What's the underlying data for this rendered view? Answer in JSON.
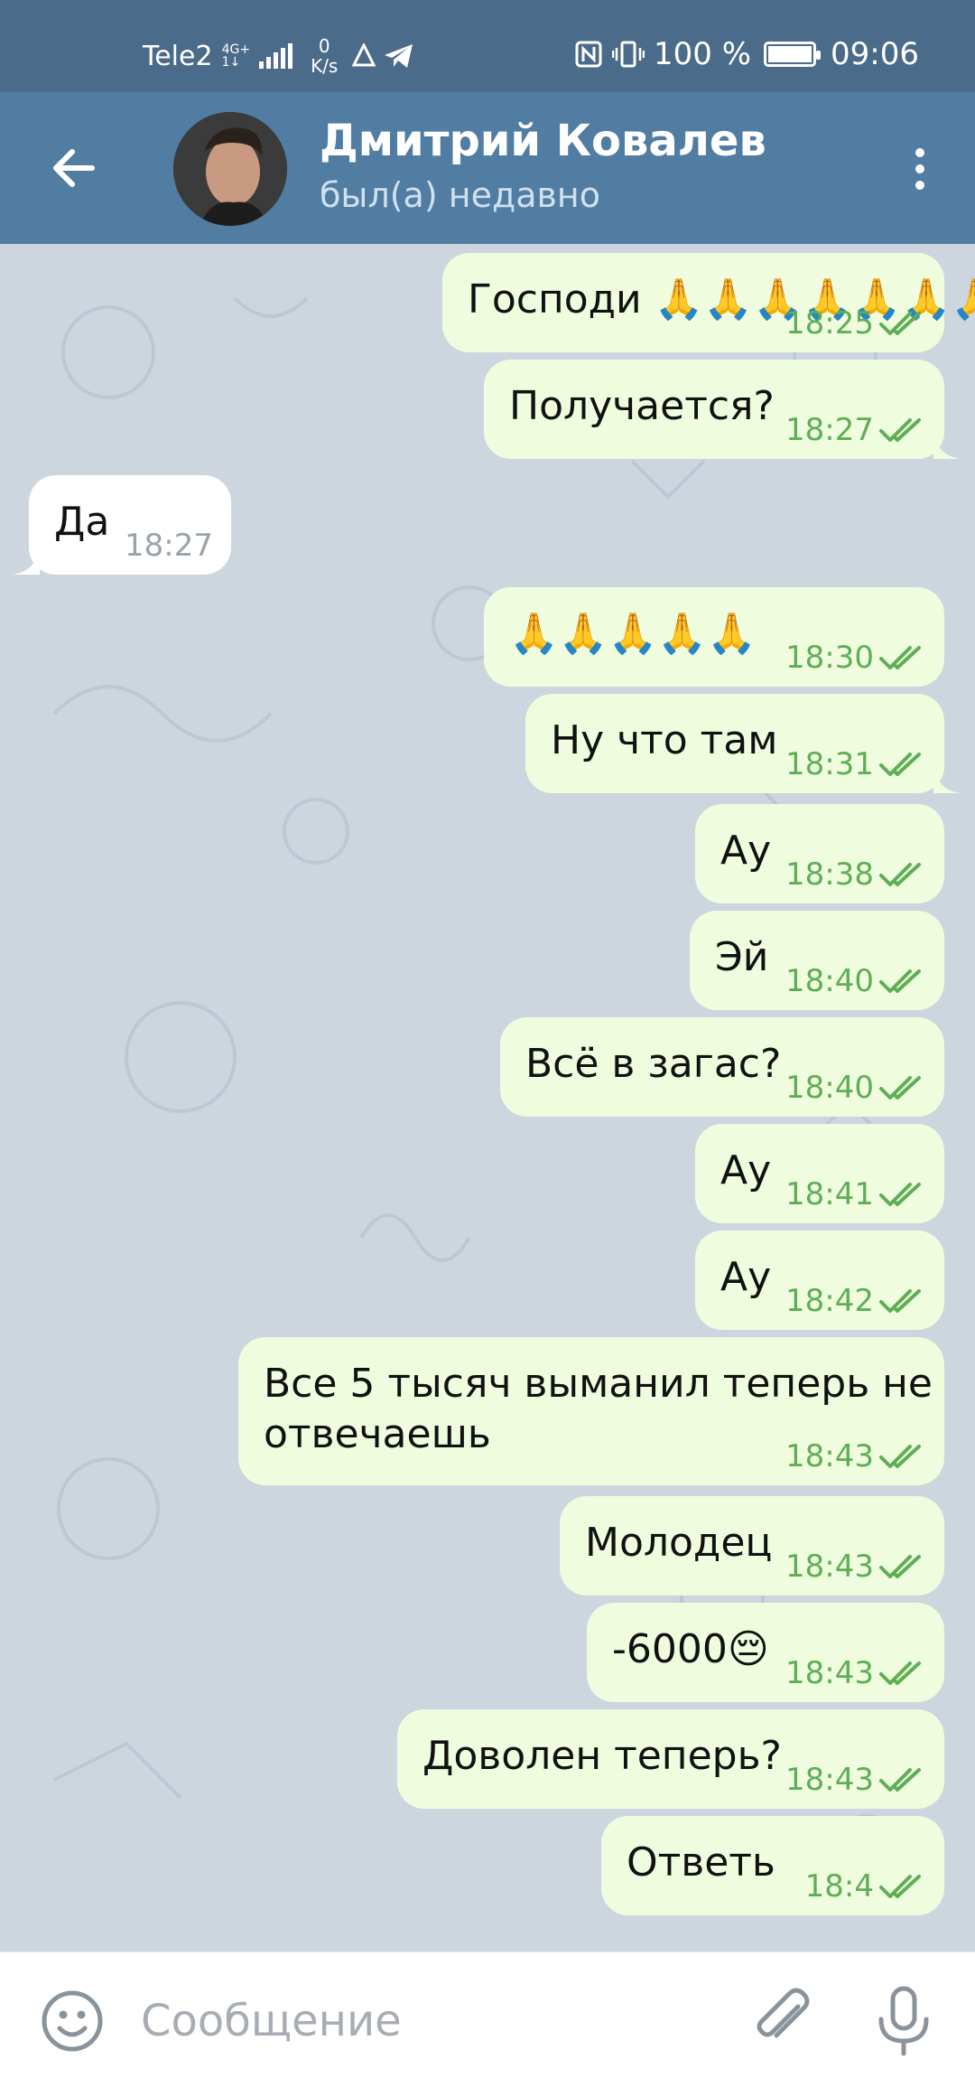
{
  "status_bar": {
    "carrier": "Tele2",
    "network": "4G+",
    "network_sub": "1↓",
    "speed_value": "0",
    "speed_unit": "K/s",
    "battery": "100 %",
    "time": "09:06",
    "icons": [
      "signal-icon",
      "telegram-icon",
      "nfc-icon",
      "vibrate-icon",
      "battery-icon"
    ]
  },
  "header": {
    "name": "Дмитрий Ковалев",
    "status": "был(а) недавно",
    "back_icon": "arrow-left-icon",
    "menu_icon": "more-vertical-icon"
  },
  "messages": [
    {
      "dir": "out",
      "text": "Господи 🙏🙏🙏🙏🙏🙏🙏",
      "time": "18:25",
      "read": true
    },
    {
      "dir": "out",
      "text": "Получается?",
      "time": "18:27",
      "read": true
    },
    {
      "dir": "in",
      "text": "Да",
      "time": "18:27"
    },
    {
      "dir": "out",
      "text": "🙏🙏🙏🙏🙏",
      "time": "18:30",
      "read": true
    },
    {
      "dir": "out",
      "text": "Ну что там",
      "time": "18:31",
      "read": true
    },
    {
      "dir": "out",
      "text": "Ау",
      "time": "18:38",
      "read": true
    },
    {
      "dir": "out",
      "text": "Эй",
      "time": "18:40",
      "read": true
    },
    {
      "dir": "out",
      "text": "Всё в загас?",
      "time": "18:40",
      "read": true
    },
    {
      "dir": "out",
      "text": "Ау",
      "time": "18:41",
      "read": true
    },
    {
      "dir": "out",
      "text": "Ау",
      "time": "18:42",
      "read": true
    },
    {
      "dir": "out",
      "text": "Все 5 тысяч выманил теперь не отвечаешь",
      "line1": "Все 5 тысяч выманил теперь не",
      "line2": "отвечаешь",
      "time": "18:43",
      "read": true
    },
    {
      "dir": "out",
      "text": "Молодец",
      "time": "18:43",
      "read": true
    },
    {
      "dir": "out",
      "text": "-6000😔",
      "time": "18:43",
      "read": true
    },
    {
      "dir": "out",
      "text": "Доволен теперь?",
      "time": "18:43",
      "read": true
    },
    {
      "dir": "out",
      "text": "Ответь",
      "time": "18:4",
      "read": true
    }
  ],
  "input": {
    "placeholder": "Сообщение",
    "value": "",
    "emoji_icon": "emoji-smile-icon",
    "attach_icon": "paperclip-icon",
    "mic_icon": "microphone-icon"
  },
  "scroll_down_icon": "chevron-down-icon",
  "colors": {
    "statusbar": "#4a6b89",
    "header": "#517da2",
    "chat_bg": "#cdd6df",
    "bubble_out": "#effdde",
    "bubble_in": "#ffffff",
    "time_out": "#5fae55",
    "time_in": "#9aa3ab"
  }
}
